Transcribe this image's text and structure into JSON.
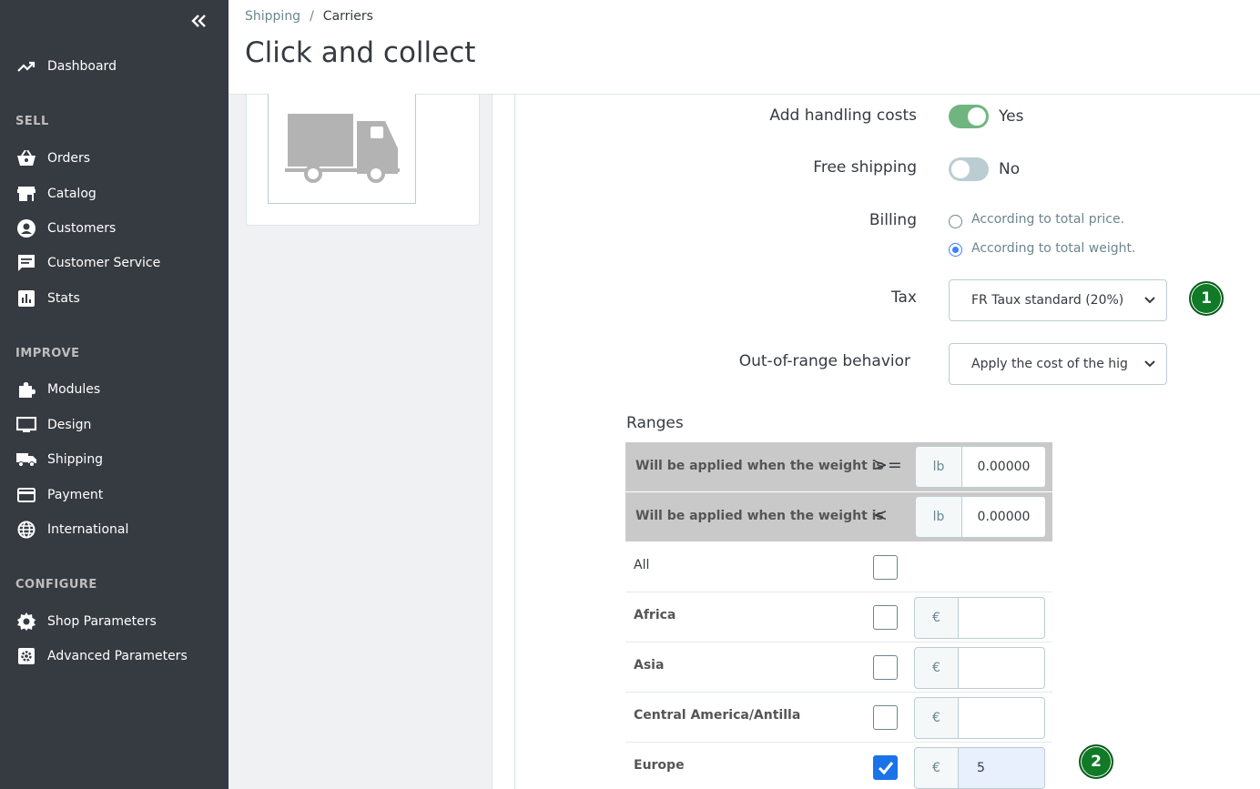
{
  "sidebar": {
    "collapse_icon": "double-chevron-left-icon",
    "dashboard": "Dashboard",
    "sections": {
      "sell": "SELL",
      "improve": "IMPROVE",
      "configure": "CONFIGURE"
    },
    "items": {
      "orders": "Orders",
      "catalog": "Catalog",
      "customers": "Customers",
      "customer_service": "Customer Service",
      "stats": "Stats",
      "modules": "Modules",
      "design": "Design",
      "shipping": "Shipping",
      "payment": "Payment",
      "international": "International",
      "shop_parameters": "Shop Parameters",
      "advanced_parameters": "Advanced Parameters"
    }
  },
  "header": {
    "breadcrumb": [
      "Shipping",
      "/",
      "Carriers"
    ],
    "title": "Click and collect"
  },
  "form": {
    "handling": {
      "label": "Add handling costs",
      "value": "Yes",
      "on": true
    },
    "free_shipping": {
      "label": "Free shipping",
      "value": "No",
      "on": false
    },
    "billing": {
      "label": "Billing",
      "options": [
        "According to total price.",
        "According to total weight."
      ],
      "selected": 1
    },
    "tax": {
      "label": "Tax",
      "value": "FR Taux standard (20%)"
    },
    "out_of_range": {
      "label": "Out-of-range behavior",
      "value": "Apply the cost of the highest defined range"
    }
  },
  "badges": [
    "1",
    "2"
  ],
  "ranges": {
    "title": "Ranges",
    "rows": [
      {
        "label": "Will be applied when the weight is",
        "op": ">=",
        "unit": "lb",
        "value": "0.00000"
      },
      {
        "label": "Will be applied when the weight is",
        "op": "<",
        "unit": "lb",
        "value": "0.00000"
      }
    ],
    "all_label": "All",
    "currency": "€",
    "zones": [
      {
        "name": "Africa",
        "checked": false,
        "price": ""
      },
      {
        "name": "Asia",
        "checked": false,
        "price": ""
      },
      {
        "name": "Central America/Antilla",
        "checked": false,
        "price": ""
      },
      {
        "name": "Europe",
        "checked": true,
        "price": "5"
      }
    ]
  },
  "colors": {
    "sidebar_bg": "#363a41",
    "switch_on": "#70b580",
    "switch_off": "#bbcdd2",
    "badge": "#117a27",
    "checkbox_checked": "#1a73e8"
  }
}
